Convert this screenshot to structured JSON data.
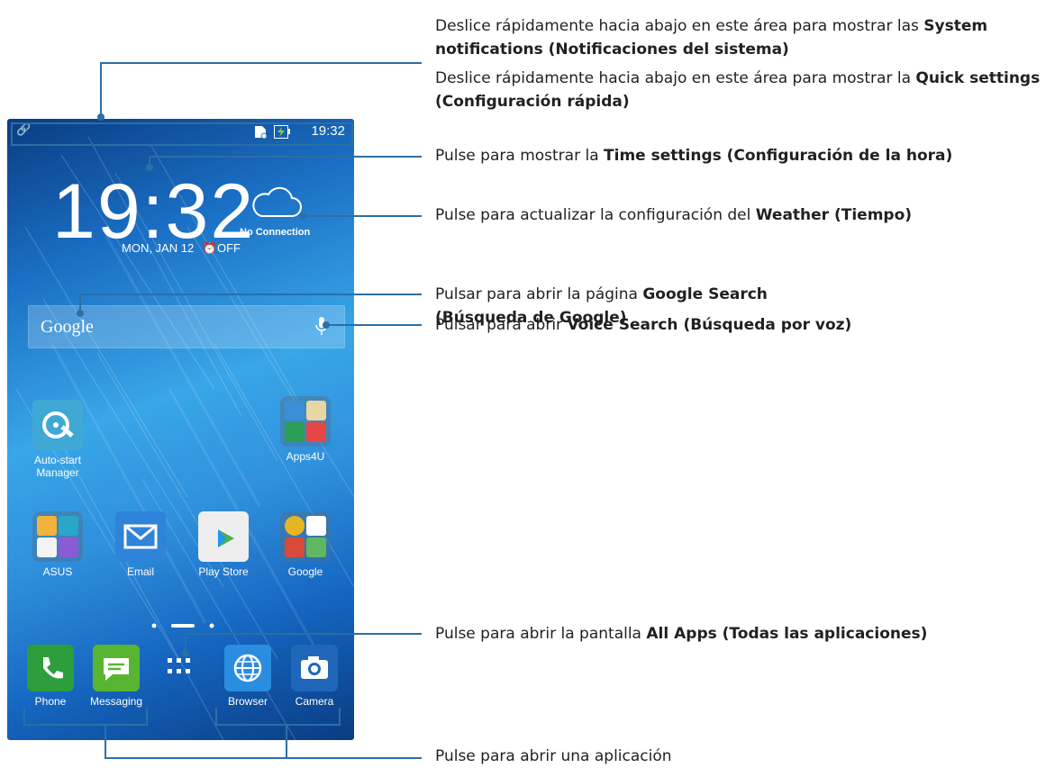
{
  "phone": {
    "status_time": "19:32",
    "clock": "19:32",
    "date": "MON, JAN 12",
    "alarm": "OFF",
    "weather_status": "No Connection",
    "search_brand": "Google",
    "apps": [
      {
        "label": "Auto-start Manager",
        "icon": "auto-start-icon"
      },
      {
        "label": "Apps4U",
        "icon": "folder-icon"
      },
      {
        "label": "ASUS",
        "icon": "folder-icon"
      },
      {
        "label": "Email",
        "icon": "email-icon"
      },
      {
        "label": "Play Store",
        "icon": "play-store-icon"
      },
      {
        "label": "Google",
        "icon": "folder-icon"
      }
    ],
    "dock": [
      {
        "label": "Phone",
        "icon": "phone-icon",
        "color": "#2e9d3b"
      },
      {
        "label": "Messaging",
        "icon": "messaging-icon",
        "color": "#58b531"
      },
      {
        "label": "Browser",
        "icon": "globe-icon",
        "color": "#2a8de0"
      },
      {
        "label": "Camera",
        "icon": "camera-icon",
        "color": "#1f67b8"
      }
    ],
    "all_apps_icon": "grid-icon"
  },
  "annotations": {
    "notifications_pre": "Deslice rápidamente hacia abajo en este área para mostrar las ",
    "notifications_bold": "System notifications (Notificaciones del sistema)",
    "quick_pre": "Deslice rápidamente hacia abajo en este área para mostrar la ",
    "quick_bold": "Quick settings (Configuración rápida)",
    "time_pre": "Pulse para mostrar la ",
    "time_bold": "Time settings (Configuración de la hora)",
    "weather_pre": "Pulse para actualizar la configuración del ",
    "weather_bold": "Weather (Tiempo)",
    "google_pre": "Pulsar para abrir la página ",
    "google_bold": "Google Search (Búsqueda de Google)",
    "voice_pre": "Pulsar para abrir ",
    "voice_bold": "Voice Search (Búsqueda por voz)",
    "allapps_pre": "Pulse para abrir la pantalla ",
    "allapps_bold": "All Apps (Todas las aplicaciones)",
    "openapp": "Pulse para abrir una aplicación"
  },
  "colors": {
    "callout_line": "#2b6fa5",
    "annotation_text": "#231f20"
  }
}
